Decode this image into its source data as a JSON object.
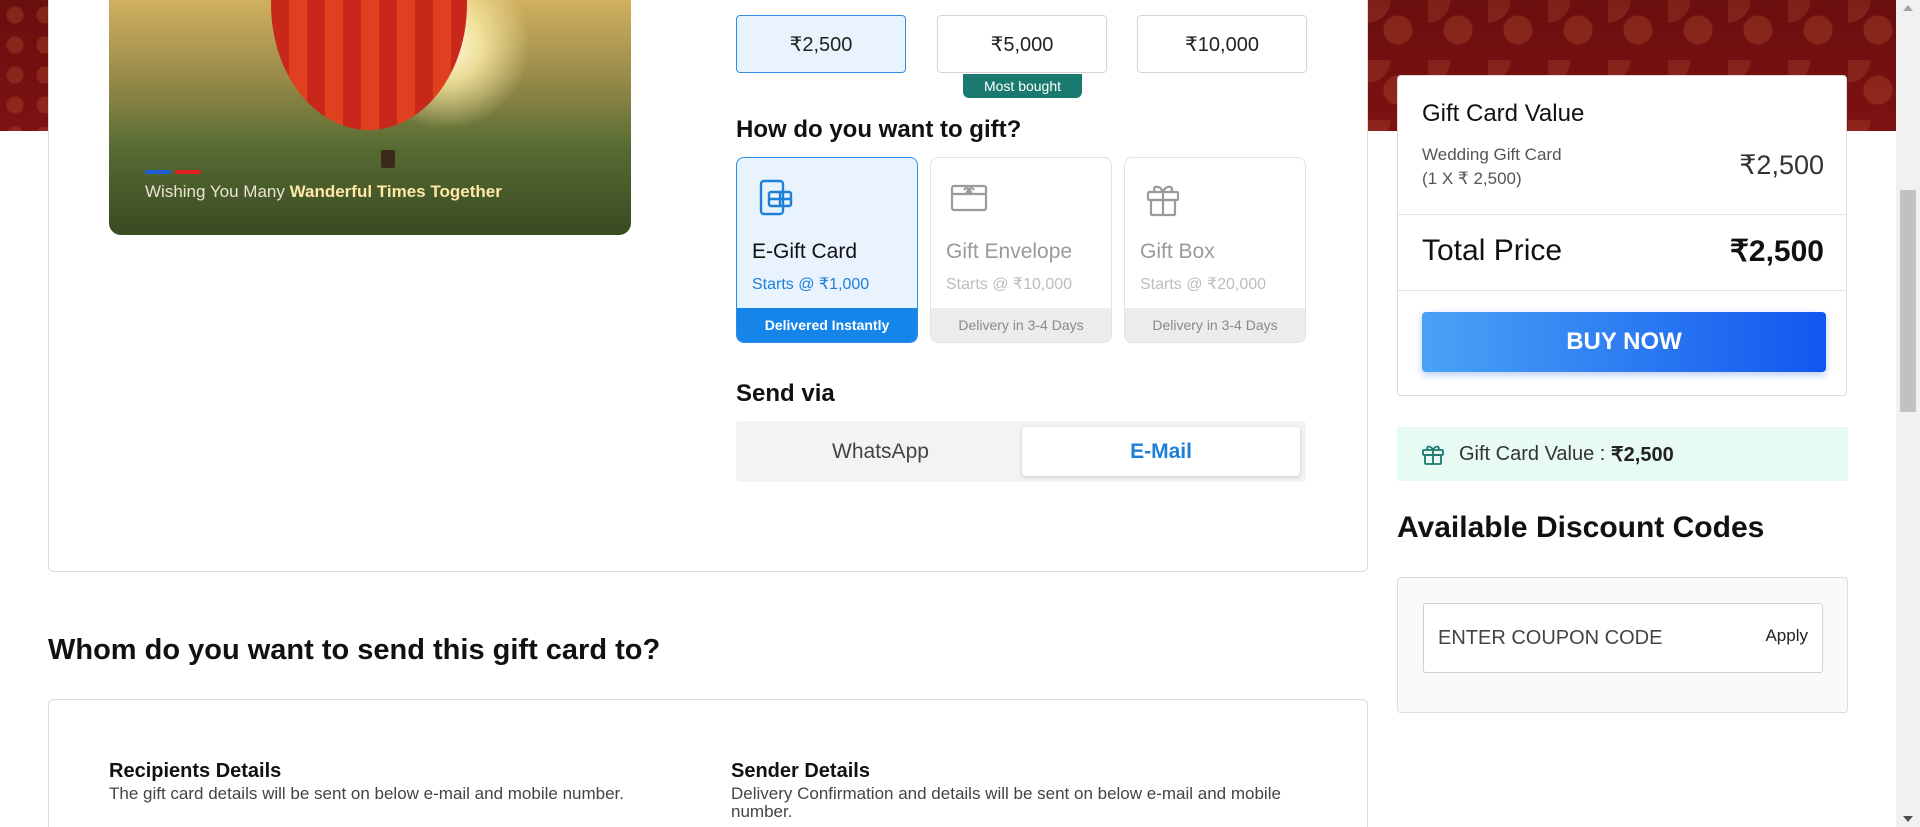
{
  "denominations": [
    {
      "label": "₹2,500"
    },
    {
      "label": "₹5,000"
    },
    {
      "label": "₹10,000"
    }
  ],
  "most_bought_badge": "Most bought",
  "hero": {
    "caption_prefix": "Wishing You Many ",
    "caption_bold": "Wanderful Times Together"
  },
  "gift_method": {
    "title": "How do you want to gift?",
    "options": [
      {
        "name": "E-Gift Card",
        "price": "Starts @ ₹1,000",
        "delivery": "Delivered Instantly"
      },
      {
        "name": "Gift Envelope",
        "price": "Starts @ ₹10,000",
        "delivery": "Delivery in 3-4 Days"
      },
      {
        "name": "Gift Box",
        "price": "Starts @ ₹20,000",
        "delivery": "Delivery in 3-4 Days"
      }
    ]
  },
  "send_via": {
    "title": "Send via",
    "whatsapp": "WhatsApp",
    "email": "E-Mail"
  },
  "summary": {
    "title": "Gift Card Value",
    "item_name": "Wedding Gift Card",
    "item_qty": "(1 X ₹ 2,500)",
    "item_value": "₹2,500",
    "total_label": "Total Price",
    "total_value": "₹2,500",
    "buy_label": "BUY NOW"
  },
  "gift_value_banner": {
    "label": "Gift Card Value : ",
    "value": "₹2,500"
  },
  "discount": {
    "title": "Available Discount Codes",
    "placeholder": "ENTER COUPON CODE",
    "apply_label": "Apply"
  },
  "recipient_section": {
    "title": "Whom do you want to send this gift card to?",
    "recipients_title": "Recipients Details",
    "recipients_desc": "The gift card details will be sent on below e-mail and mobile number.",
    "sender_title": "Sender Details",
    "sender_desc": "Delivery Confirmation and details will be sent on below e-mail and mobile number."
  },
  "colors": {
    "accent_blue": "#1585ea",
    "badge_green": "#1b7a6f",
    "banner_bg": "#e7faf3",
    "header_maroon": "#6a0e0e"
  }
}
